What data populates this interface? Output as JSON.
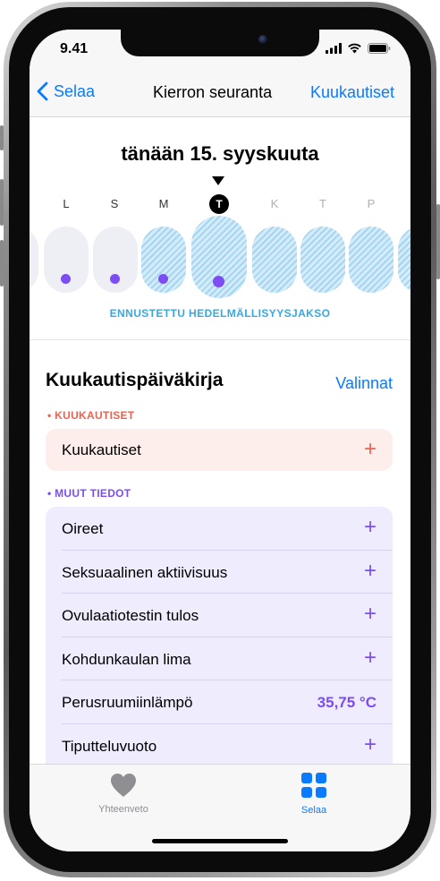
{
  "status": {
    "time": "9.41"
  },
  "nav": {
    "back_label": "Selaa",
    "title": "Kierron seuranta",
    "right_label": "Kuukautiset"
  },
  "calendar": {
    "today_label": "tänään 15. syyskuuta",
    "days": [
      "L",
      "S",
      "M",
      "T",
      "K",
      "T",
      "P"
    ],
    "today_index": 3,
    "fertile_label": "ENNUSTETTU HEDELMÄLLISYYSJAKSO"
  },
  "log": {
    "title": "Kuukautispäiväkirja",
    "options_label": "Valinnat",
    "period_category": "KUUKAUTISET",
    "period_row": "Kuukautiset",
    "other_category": "MUUT TIEDOT",
    "rows": [
      {
        "label": "Oireet"
      },
      {
        "label": "Seksuaalinen aktiivisuus"
      },
      {
        "label": "Ovulaatiotestin tulos"
      },
      {
        "label": "Kohdunkaulan lima"
      },
      {
        "label": "Perusruumiinlämpö",
        "value": "35,75 °C"
      },
      {
        "label": "Tiputteluvuoto"
      }
    ]
  },
  "tabs": [
    {
      "label": "Yhteenveto",
      "icon": "heart-icon",
      "active": false
    },
    {
      "label": "Selaa",
      "icon": "grid-icon",
      "active": true
    }
  ],
  "colors": {
    "accent": "#0a7aff",
    "period": "#f0624f",
    "other": "#7b4df3",
    "fertile": "#38a9e0"
  }
}
